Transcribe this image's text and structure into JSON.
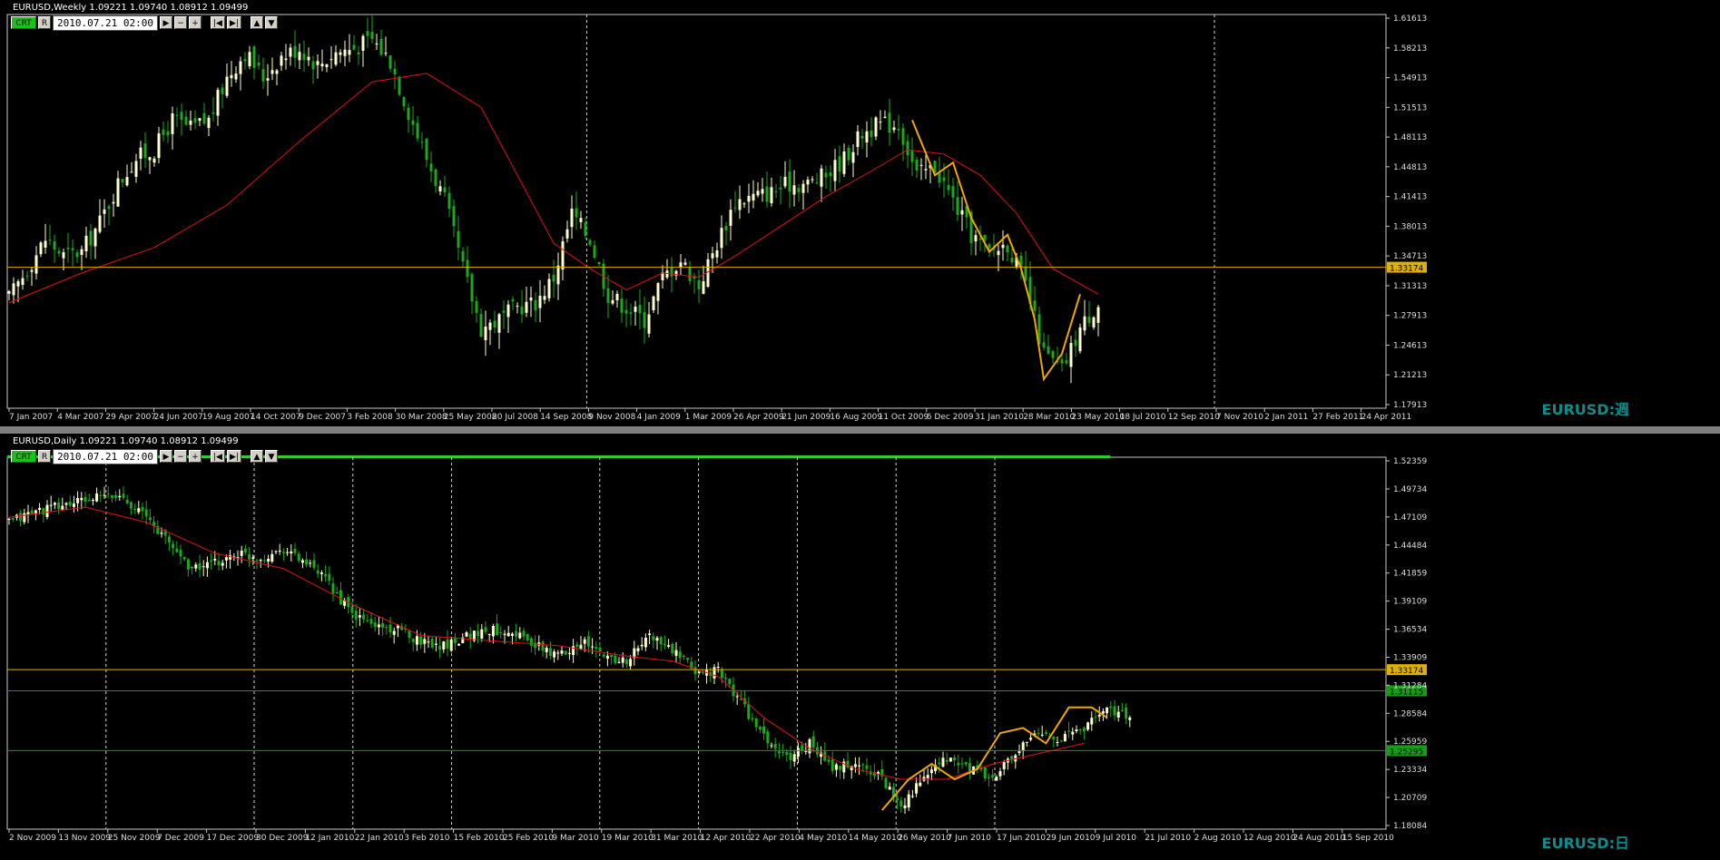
{
  "panels": [
    {
      "id": "weekly",
      "header": "EURUSD,Weekly  1.09221 1.09740 1.08912 1.09499",
      "symbol_label": "EURUSD:週",
      "toolbar": {
        "crt": "CRT",
        "r": "R",
        "date": "2010.07.21 02:00"
      },
      "colors": {
        "bull": "#ffffcc",
        "bear": "#1aaa1a",
        "ma": "#e01010",
        "hline": "#e0b000",
        "zigzag": "#f0a800",
        "grid": "#cfcfcf"
      },
      "hlines": [
        {
          "price": 1.33174,
          "label": "1.33174",
          "color": "#e0b000"
        }
      ],
      "vlines_date_index": [
        12,
        25,
        38,
        51
      ],
      "chart_data": {
        "type": "candlestick",
        "ylim": [
          1.17,
          1.625
        ],
        "price_ticks": [
          "1.61613",
          "1.58213",
          "1.54913",
          "1.51513",
          "1.48113",
          "1.44813",
          "1.41413",
          "1.38013",
          "1.34713",
          "1.31313",
          "1.27913",
          "1.24613",
          "1.21213",
          "1.17913"
        ],
        "date_ticks": [
          "7 Jan 2007",
          "4 Mar 2007",
          "29 Apr 2007",
          "24 Jun 2007",
          "19 Aug 2007",
          "14 Oct 2007",
          "9 Dec 2007",
          "3 Feb 2008",
          "30 Mar 2008",
          "25 May 2008",
          "20 Jul 2008",
          "14 Sep 2008",
          "9 Nov 2008",
          "4 Jan 2009",
          "1 Mar 2009",
          "26 Apr 2009",
          "21 Jun 2009",
          "16 Aug 2009",
          "11 Oct 2009",
          "6 Dec 2009",
          "31 Jan 2010",
          "28 Mar 2010",
          "23 May 2010",
          "18 Jul 2010",
          "12 Sep 2010",
          "7 Nov 2010",
          "2 Jan 2011",
          "27 Feb 2011",
          "24 Apr 2011"
        ],
        "path_points": [
          [
            0,
            1.295
          ],
          [
            4,
            1.33
          ],
          [
            8,
            1.365
          ],
          [
            12,
            1.345
          ],
          [
            16,
            1.35
          ],
          [
            20,
            1.385
          ],
          [
            24,
            1.43
          ],
          [
            28,
            1.46
          ],
          [
            32,
            1.47
          ],
          [
            36,
            1.505
          ],
          [
            40,
            1.495
          ],
          [
            44,
            1.505
          ],
          [
            48,
            1.555
          ],
          [
            52,
            1.585
          ],
          [
            56,
            1.555
          ],
          [
            60,
            1.58
          ],
          [
            64,
            1.59
          ],
          [
            68,
            1.57
          ],
          [
            72,
            1.585
          ],
          [
            76,
            1.59
          ],
          [
            80,
            1.6
          ],
          [
            84,
            1.575
          ],
          [
            88,
            1.515
          ],
          [
            92,
            1.46
          ],
          [
            96,
            1.41
          ],
          [
            100,
            1.33
          ],
          [
            104,
            1.26
          ],
          [
            108,
            1.27
          ],
          [
            112,
            1.285
          ],
          [
            116,
            1.29
          ],
          [
            120,
            1.32
          ],
          [
            124,
            1.395
          ],
          [
            128,
            1.365
          ],
          [
            132,
            1.3
          ],
          [
            136,
            1.285
          ],
          [
            140,
            1.27
          ],
          [
            144,
            1.32
          ],
          [
            148,
            1.34
          ],
          [
            152,
            1.31
          ],
          [
            156,
            1.36
          ],
          [
            160,
            1.41
          ],
          [
            164,
            1.415
          ],
          [
            168,
            1.42
          ],
          [
            172,
            1.43
          ],
          [
            176,
            1.43
          ],
          [
            180,
            1.44
          ],
          [
            184,
            1.46
          ],
          [
            188,
            1.49
          ],
          [
            192,
            1.5
          ],
          [
            196,
            1.5
          ],
          [
            200,
            1.44
          ],
          [
            204,
            1.45
          ],
          [
            208,
            1.41
          ],
          [
            212,
            1.37
          ],
          [
            216,
            1.35
          ],
          [
            220,
            1.36
          ],
          [
            224,
            1.31
          ],
          [
            228,
            1.23
          ],
          [
            232,
            1.21
          ],
          [
            236,
            1.26
          ],
          [
            240,
            1.29
          ]
        ],
        "moving_average": [
          [
            0,
            1.29
          ],
          [
            16,
            1.325
          ],
          [
            32,
            1.355
          ],
          [
            48,
            1.405
          ],
          [
            64,
            1.48
          ],
          [
            80,
            1.55
          ],
          [
            92,
            1.56
          ],
          [
            104,
            1.52
          ],
          [
            112,
            1.44
          ],
          [
            120,
            1.36
          ],
          [
            128,
            1.33
          ],
          [
            136,
            1.305
          ],
          [
            144,
            1.325
          ],
          [
            152,
            1.32
          ],
          [
            160,
            1.345
          ],
          [
            170,
            1.38
          ],
          [
            180,
            1.415
          ],
          [
            190,
            1.445
          ],
          [
            198,
            1.47
          ],
          [
            206,
            1.465
          ],
          [
            214,
            1.44
          ],
          [
            222,
            1.395
          ],
          [
            230,
            1.33
          ],
          [
            240,
            1.3
          ]
        ],
        "zigzag": [
          [
            199,
            1.505
          ],
          [
            204,
            1.44
          ],
          [
            208,
            1.455
          ],
          [
            212,
            1.39
          ],
          [
            216,
            1.35
          ],
          [
            220,
            1.37
          ],
          [
            223,
            1.33
          ],
          [
            226,
            1.27
          ],
          [
            228,
            1.2
          ],
          [
            232,
            1.23
          ],
          [
            236,
            1.3
          ]
        ]
      }
    },
    {
      "id": "daily",
      "header": "EURUSD,Daily  1.09221 1.09740 1.08912 1.09499",
      "symbol_label": "EURUSD:日",
      "toolbar": {
        "crt": "CRT",
        "r": "R",
        "date": "2010.07.21 02:00"
      },
      "colors": {
        "bull": "#ffffcc",
        "bear": "#1aaa1a",
        "ma": "#e01010",
        "hline": "#e0b000",
        "zigzag": "#f0a800",
        "grid": "#cfcfcf",
        "green_line": "#179c17",
        "progress": "#2ecc2e"
      },
      "hlines": [
        {
          "price": 1.33174,
          "label": "1.33174",
          "color": "#e0b000"
        },
        {
          "price": 1.31115,
          "label": "1.31115",
          "color": "#179c17"
        },
        {
          "price": 1.25295,
          "label": "1.25295",
          "color": "#179c17"
        }
      ],
      "vlines_date_index": [
        2,
        5,
        7,
        9,
        12,
        14,
        16,
        18,
        20
      ],
      "chart_data": {
        "type": "candlestick",
        "ylim": [
          1.18,
          1.535
        ],
        "price_ticks": [
          "1.52359",
          "1.49734",
          "1.47109",
          "1.44484",
          "1.41859",
          "1.39109",
          "1.36534",
          "1.33909",
          "1.31284",
          "1.28584",
          "1.25959",
          "1.23334",
          "1.20709",
          "1.18084"
        ],
        "date_ticks": [
          "2 Nov 2009",
          "13 Nov 2009",
          "25 Nov 2009",
          "7 Dec 2009",
          "17 Dec 2009",
          "30 Dec 2009",
          "12 Jan 2010",
          "22 Jan 2010",
          "3 Feb 2010",
          "15 Feb 2010",
          "25 Feb 2010",
          "9 Mar 2010",
          "19 Mar 2010",
          "31 Mar 2010",
          "12 Apr 2010",
          "22 Apr 2010",
          "4 May 2010",
          "14 May 2010",
          "26 May 2010",
          "7 Jun 2010",
          "17 Jun 2010",
          "29 Jun 2010",
          "9 Jul 2010",
          "21 Jul 2010",
          "2 Aug 2010",
          "12 Aug 2010",
          "24 Aug 2010",
          "15 Sep 2010"
        ],
        "path_points": [
          [
            0,
            1.475
          ],
          [
            6,
            1.485
          ],
          [
            12,
            1.49
          ],
          [
            18,
            1.495
          ],
          [
            24,
            1.5
          ],
          [
            30,
            1.5
          ],
          [
            36,
            1.48
          ],
          [
            42,
            1.455
          ],
          [
            48,
            1.43
          ],
          [
            54,
            1.435
          ],
          [
            60,
            1.445
          ],
          [
            66,
            1.44
          ],
          [
            72,
            1.45
          ],
          [
            78,
            1.435
          ],
          [
            84,
            1.415
          ],
          [
            90,
            1.385
          ],
          [
            96,
            1.375
          ],
          [
            102,
            1.37
          ],
          [
            108,
            1.36
          ],
          [
            114,
            1.355
          ],
          [
            120,
            1.365
          ],
          [
            126,
            1.37
          ],
          [
            132,
            1.37
          ],
          [
            138,
            1.355
          ],
          [
            144,
            1.345
          ],
          [
            150,
            1.36
          ],
          [
            156,
            1.345
          ],
          [
            162,
            1.34
          ],
          [
            168,
            1.365
          ],
          [
            174,
            1.35
          ],
          [
            180,
            1.33
          ],
          [
            186,
            1.33
          ],
          [
            192,
            1.3
          ],
          [
            198,
            1.265
          ],
          [
            204,
            1.245
          ],
          [
            210,
            1.26
          ],
          [
            216,
            1.235
          ],
          [
            222,
            1.24
          ],
          [
            228,
            1.23
          ],
          [
            234,
            1.2
          ],
          [
            240,
            1.225
          ],
          [
            246,
            1.245
          ],
          [
            252,
            1.235
          ],
          [
            258,
            1.225
          ],
          [
            264,
            1.25
          ],
          [
            270,
            1.27
          ],
          [
            276,
            1.265
          ],
          [
            282,
            1.275
          ],
          [
            288,
            1.295
          ],
          [
            294,
            1.285
          ]
        ],
        "moving_average": [
          [
            0,
            1.48
          ],
          [
            20,
            1.49
          ],
          [
            36,
            1.475
          ],
          [
            54,
            1.445
          ],
          [
            72,
            1.43
          ],
          [
            90,
            1.395
          ],
          [
            108,
            1.365
          ],
          [
            126,
            1.36
          ],
          [
            144,
            1.355
          ],
          [
            162,
            1.345
          ],
          [
            174,
            1.34
          ],
          [
            186,
            1.325
          ],
          [
            198,
            1.285
          ],
          [
            210,
            1.255
          ],
          [
            222,
            1.235
          ],
          [
            234,
            1.225
          ],
          [
            246,
            1.225
          ],
          [
            258,
            1.24
          ],
          [
            270,
            1.25
          ],
          [
            282,
            1.26
          ]
        ],
        "zigzag": [
          [
            229,
            1.195
          ],
          [
            236,
            1.225
          ],
          [
            242,
            1.24
          ],
          [
            248,
            1.225
          ],
          [
            254,
            1.235
          ],
          [
            260,
            1.27
          ],
          [
            266,
            1.275
          ],
          [
            272,
            1.26
          ],
          [
            278,
            1.295
          ],
          [
            284,
            1.295
          ],
          [
            288,
            1.285
          ]
        ]
      }
    }
  ]
}
